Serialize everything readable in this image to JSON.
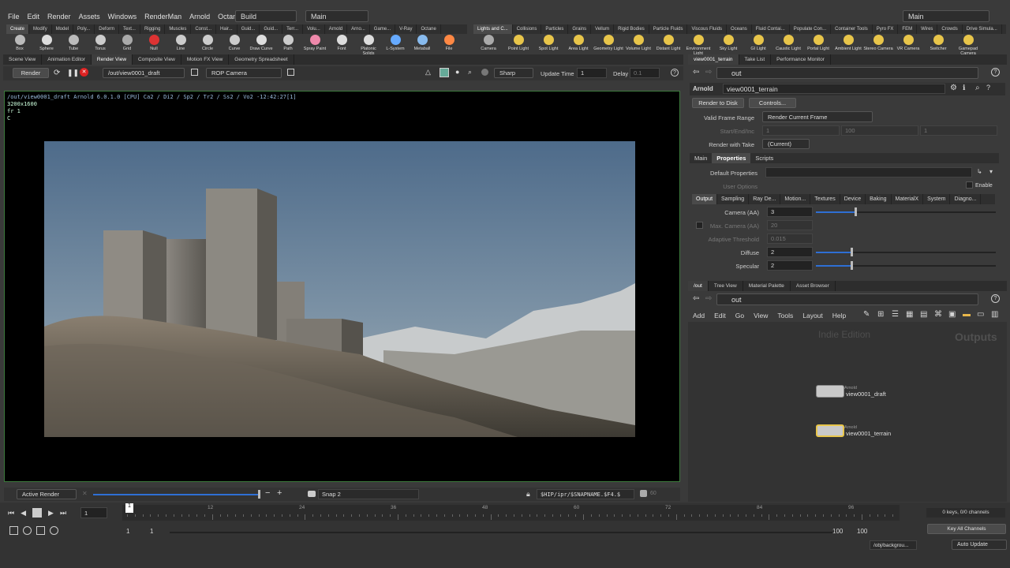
{
  "menu": [
    "File",
    "Edit",
    "Render",
    "Assets",
    "Windows",
    "RenderMan",
    "Arnold",
    "Octane",
    "Help"
  ],
  "desktop_build": "Build",
  "desktop_main": "Main",
  "right_main": "Main",
  "shelf_left_tabs": [
    "Create",
    "Modify",
    "Model",
    "Poly...",
    "Deform",
    "Text...",
    "Rigging",
    "Muscles",
    "Const...",
    "Hair...",
    "Guid...",
    "Guid...",
    "Terr...",
    "Volu...",
    "Arnold",
    "Arno...",
    "Game...",
    "V-Ray",
    "Octane"
  ],
  "shelf_left_tools": [
    "Box",
    "Sphere",
    "Tube",
    "Torus",
    "Grid",
    "Null",
    "Line",
    "Circle",
    "Curve",
    "Draw Curve",
    "Path",
    "Spray Paint",
    "Font",
    "Platonic Solids",
    "L-System",
    "Metaball",
    "File"
  ],
  "shelf_right_tabs": [
    "Lights and C...",
    "Collisions",
    "Particles",
    "Grains",
    "Vellum",
    "Rigid Bodies",
    "Particle Fluids",
    "Viscous Fluids",
    "Oceans",
    "Fluid Contai...",
    "Populate Con...",
    "Container Tools",
    "Pyro FX",
    "FEM",
    "Wires",
    "Crowds",
    "Drive Simula..."
  ],
  "shelf_right_tools": [
    "Camera",
    "Point Light",
    "Spot Light",
    "Area Light",
    "Geometry Light",
    "Volume Light",
    "Distant Light",
    "Environment Light",
    "Sky Light",
    "GI Light",
    "Caustic Light",
    "Portal Light",
    "Ambient Light",
    "Stereo Camera",
    "VR Camera",
    "Switcher",
    "Gamepad Camera"
  ],
  "left_pane_tabs": [
    "Scene View",
    "Animation Editor",
    "Render View",
    "Composite View",
    "Motion FX View",
    "Geometry Spreadsheet"
  ],
  "render_toolbar": {
    "render": "Render",
    "rop_path": "/out/view0001_draft",
    "camera": "ROP Camera",
    "sharp": "Sharp",
    "update_time_label": "Update Time",
    "update_time": "1",
    "delay_label": "Delay",
    "delay": "0.1"
  },
  "viewer_info": {
    "line1": "/out/view0001_draft  Arnold 6.0.1.0 [CPU]  Ca2 / Di2 / Sp2 / Tr2 / Ss2 / Vo2 -12:42:27[1]",
    "res": "3200x1600",
    "frame": "fr 1",
    "c": "C"
  },
  "viewer_bottom": {
    "active_render": "Active Render",
    "snap": "Snap 2",
    "path": "$HIP/ipr/$SNAPNAME.$F4.$",
    "num": "60"
  },
  "right_tabs": [
    "view0001_terrain",
    "Take List",
    "Performance Monitor"
  ],
  "param": {
    "path": "out",
    "node_type": "Arnold",
    "node_name": "view0001_terrain",
    "render_to_disk": "Render to Disk",
    "controls": "Controls...",
    "valid_frame_range_label": "Valid Frame Range",
    "valid_frame_range": "Render Current Frame",
    "start_end_label": "Start/End/Inc",
    "start": "1",
    "end": "100",
    "inc": "1",
    "take_label": "Render with Take",
    "take": "(Current)",
    "tabs": [
      "Main",
      "Properties",
      "Scripts"
    ],
    "default_props_label": "Default Properties",
    "user_options_label": "User Options",
    "enable": "Enable",
    "subtabs": [
      "Output",
      "Sampling",
      "Ray De...",
      "Motion...",
      "Textures",
      "Device",
      "Baking",
      "MaterialX",
      "System",
      "Diagno..."
    ],
    "camera_aa_label": "Camera (AA)",
    "camera_aa": "3",
    "max_camera_label": "Max. Camera (AA)",
    "max_camera": "20",
    "adaptive_label": "Adaptive Threshold",
    "adaptive": "0.015",
    "diffuse_label": "Diffuse",
    "diffuse": "2",
    "specular_label": "Specular",
    "specular": "2"
  },
  "net_tabs": [
    "/out",
    "Tree View",
    "Material Palette",
    "Asset Browser"
  ],
  "net": {
    "path": "out",
    "menu": [
      "Add",
      "Edit",
      "Go",
      "View",
      "Tools",
      "Layout",
      "Help"
    ],
    "watermark": "Indie Edition",
    "context": "Outputs",
    "nodes": [
      {
        "type": "Arnold",
        "name": "view0001_draft"
      },
      {
        "type": "Arnold",
        "name": "view0001_terrain"
      }
    ]
  },
  "timeline": {
    "ticks": [
      "12",
      "24",
      "36",
      "48",
      "60",
      "72",
      "84",
      "96"
    ],
    "current": "1",
    "frame_field": "1",
    "start": "1",
    "start2": "1",
    "end": "100",
    "end2": "100",
    "keys": "0 keys, 0/0 channels",
    "key_all": "Key All Channels",
    "obj_path": "/obj/backgrou...",
    "auto_update": "Auto Update"
  }
}
